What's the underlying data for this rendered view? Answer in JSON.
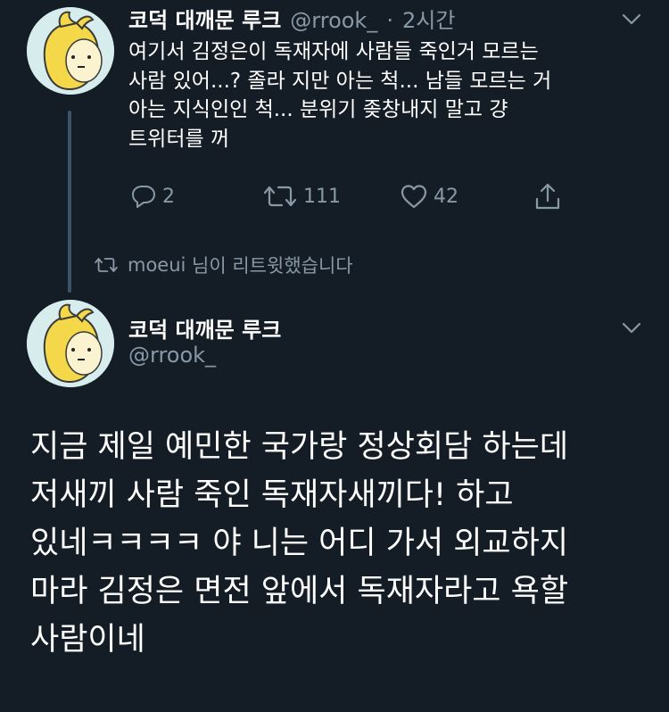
{
  "colors": {
    "background": "#141d26",
    "text_primary": "#ffffff",
    "text_secondary": "#8899a6",
    "thread_line": "#3d5466",
    "avatar_yellow": "#f5d84a",
    "avatar_bg": "#d7ecec"
  },
  "reply_tweet": {
    "display_name": "코덕 대깨문 루크",
    "handle": "@rrook_",
    "separator": "·",
    "timestamp": "2시간",
    "body_lines": [
      "여기서 김정은이 독재자에 사람들 죽인거 모르는",
      "사람 있어...? 졸라 지만 아는 척... 남들 모르는 거",
      "아는 지식인인 척... 분위기 좆창내지 말고 걍",
      "트위터를 꺼"
    ],
    "actions": {
      "reply_count": "2",
      "retweet_count": "111",
      "like_count": "42"
    },
    "icons": [
      "reply-icon",
      "retweet-icon",
      "like-icon",
      "share-icon",
      "chevron-down-icon"
    ]
  },
  "retweet_note": {
    "user": "moeui",
    "suffix": " 님이 리트윗했습니다"
  },
  "main_tweet": {
    "display_name": "코덕 대깨문 루크",
    "handle": "@rrook_",
    "body_lines": [
      "지금 제일 예민한 국가랑 정상회담 하는데",
      "저새끼 사람 죽인 독재자새끼다! 하고",
      "있네ㅋㅋㅋㅋ 야 니는 어디 가서 외교하지",
      "마라 김정은 면전 앞에서 독재자라고 욕할",
      "사람이네"
    ]
  }
}
